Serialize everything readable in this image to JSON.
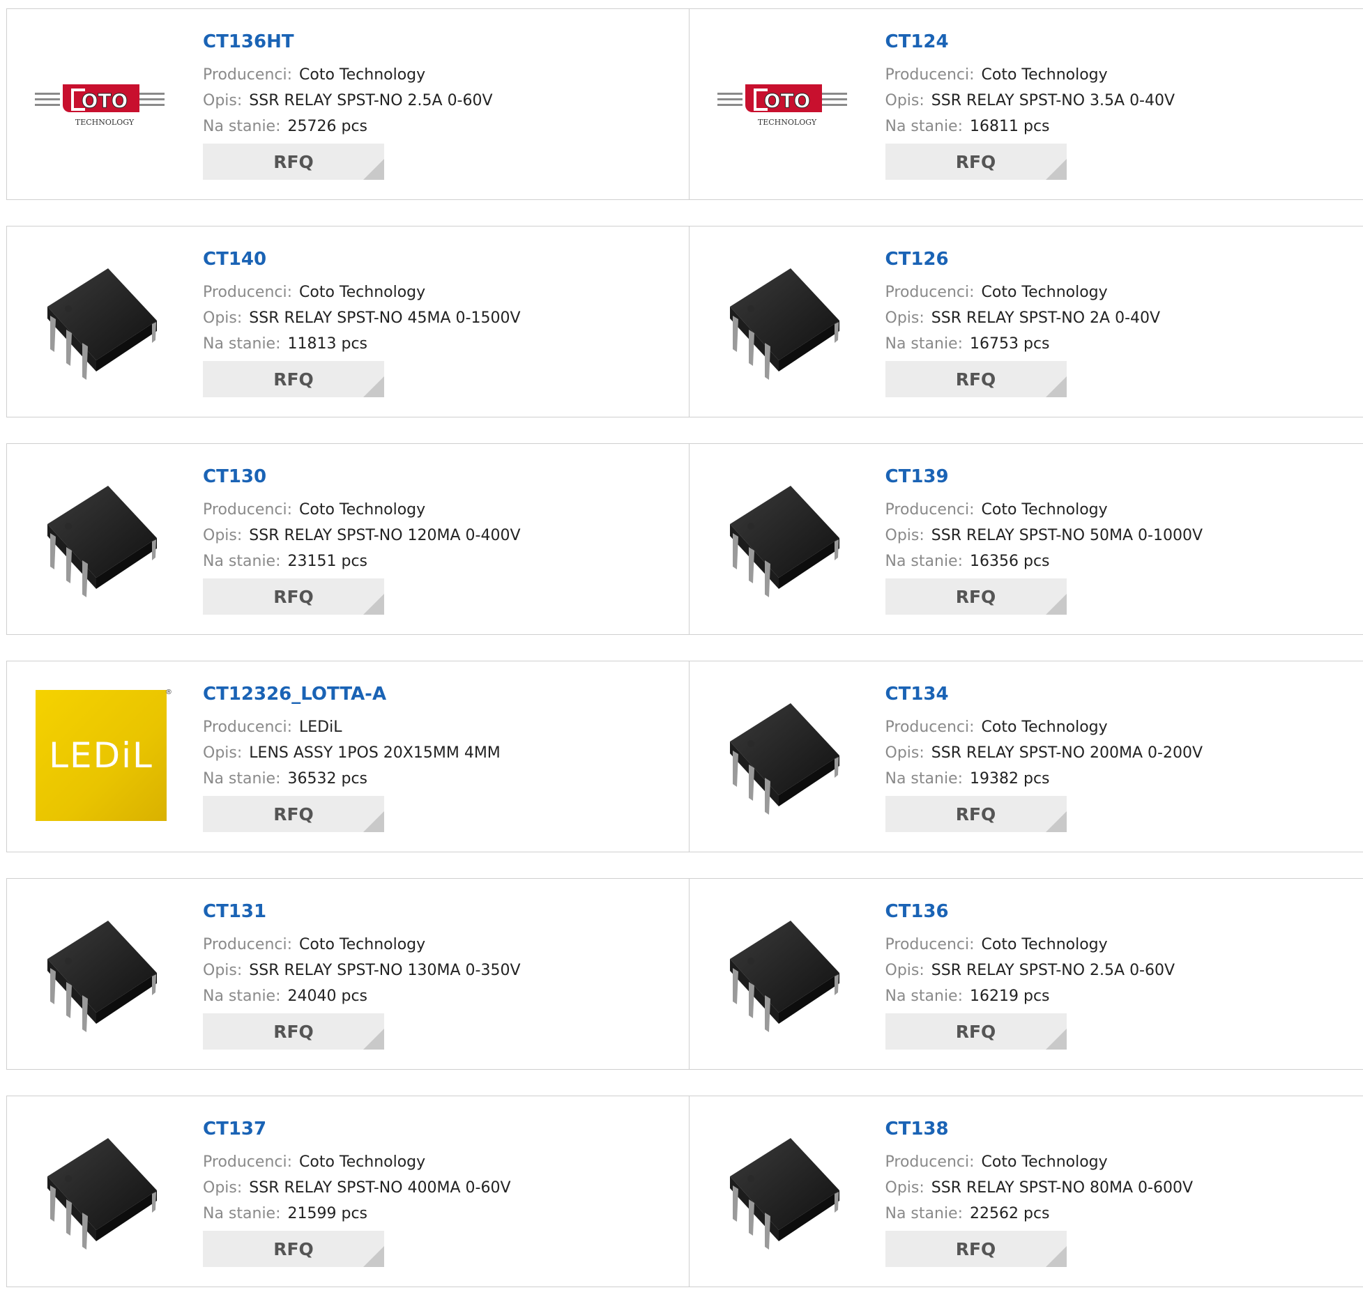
{
  "labels": {
    "manufacturer": "Producenci:",
    "description": "Opis:",
    "stock": "Na stanie:",
    "rfq": "RFQ"
  },
  "colors": {
    "title_link": "#1a63b5",
    "label": "#8a8a8a",
    "value": "#222222",
    "rfq_bg": "#ececec",
    "ledil_yellow": "#f5d200",
    "coto_red": "#c8102e"
  },
  "products": [
    {
      "part": "CT136HT",
      "manufacturer": "Coto Technology",
      "description": "SSR RELAY SPST-NO 2.5A 0-60V",
      "stock": "25726 pcs",
      "image": "coto-logo"
    },
    {
      "part": "CT124",
      "manufacturer": "Coto Technology",
      "description": "SSR RELAY SPST-NO 3.5A 0-40V",
      "stock": "16811 pcs",
      "image": "coto-logo"
    },
    {
      "part": "CT140",
      "manufacturer": "Coto Technology",
      "description": "SSR RELAY SPST-NO 45MA 0-1500V",
      "stock": "11813 pcs",
      "image": "dip-chip"
    },
    {
      "part": "CT126",
      "manufacturer": "Coto Technology",
      "description": "SSR RELAY SPST-NO 2A 0-40V",
      "stock": "16753 pcs",
      "image": "dip-chip"
    },
    {
      "part": "CT130",
      "manufacturer": "Coto Technology",
      "description": "SSR RELAY SPST-NO 120MA 0-400V",
      "stock": "23151 pcs",
      "image": "dip-chip"
    },
    {
      "part": "CT139",
      "manufacturer": "Coto Technology",
      "description": "SSR RELAY SPST-NO 50MA 0-1000V",
      "stock": "16356 pcs",
      "image": "dip-chip"
    },
    {
      "part": "CT12326_LOTTA-A",
      "manufacturer": "LEDiL",
      "description": "LENS ASSY 1POS 20X15MM 4MM",
      "stock": "36532 pcs",
      "image": "ledil-logo"
    },
    {
      "part": "CT134",
      "manufacturer": "Coto Technology",
      "description": "SSR RELAY SPST-NO 200MA 0-200V",
      "stock": "19382 pcs",
      "image": "dip-chip"
    },
    {
      "part": "CT131",
      "manufacturer": "Coto Technology",
      "description": "SSR RELAY SPST-NO 130MA 0-350V",
      "stock": "24040 pcs",
      "image": "dip-chip"
    },
    {
      "part": "CT136",
      "manufacturer": "Coto Technology",
      "description": "SSR RELAY SPST-NO 2.5A 0-60V",
      "stock": "16219 pcs",
      "image": "dip-chip"
    },
    {
      "part": "CT137",
      "manufacturer": "Coto Technology",
      "description": "SSR RELAY SPST-NO 400MA 0-60V",
      "stock": "21599 pcs",
      "image": "dip-chip"
    },
    {
      "part": "CT138",
      "manufacturer": "Coto Technology",
      "description": "SSR RELAY SPST-NO 80MA 0-600V",
      "stock": "22562 pcs",
      "image": "dip-chip"
    }
  ],
  "logos": {
    "coto_text": "OTO",
    "coto_sub": "TECHNOLOGY",
    "ledil_text": "LEDiL",
    "ledil_reg": "®"
  }
}
